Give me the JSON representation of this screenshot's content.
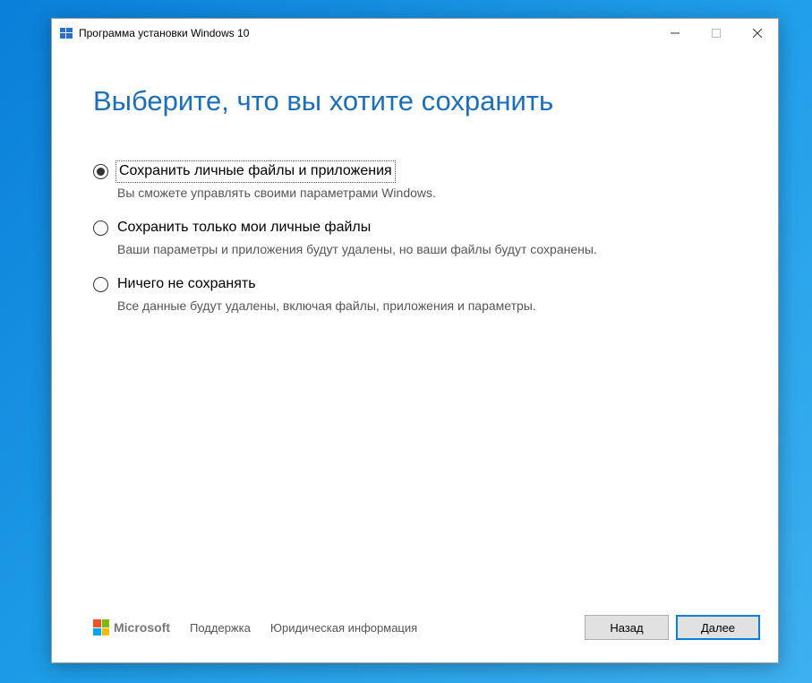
{
  "window": {
    "title": "Программа установки Windows 10"
  },
  "heading": "Выберите, что вы хотите сохранить",
  "options": [
    {
      "label": "Сохранить личные файлы и приложения",
      "description": "Вы сможете управлять своими параметрами Windows.",
      "selected": true,
      "focused": true
    },
    {
      "label": "Сохранить только мои личные файлы",
      "description": "Ваши параметры и приложения будут удалены, но ваши файлы будут сохранены.",
      "selected": false,
      "focused": false
    },
    {
      "label": "Ничего не сохранять",
      "description": "Все данные будут удалены, включая файлы, приложения и параметры.",
      "selected": false,
      "focused": false
    }
  ],
  "footer": {
    "brand": "Microsoft",
    "support_link": "Поддержка",
    "legal_link": "Юридическая информация",
    "back_button": "Назад",
    "next_button": "Далее"
  }
}
